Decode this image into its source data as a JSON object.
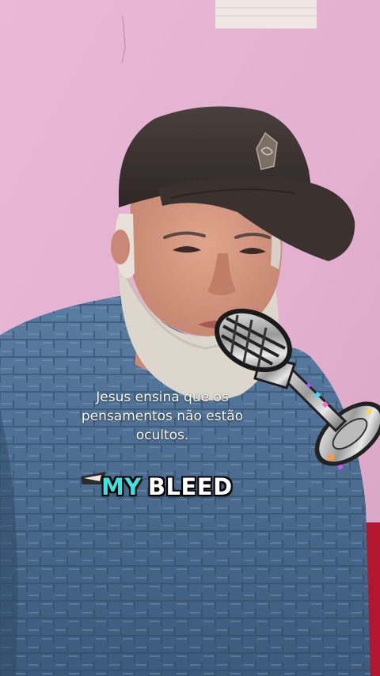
{
  "caption": {
    "line1": "Jesus ensina que os",
    "line2": "pensamentos não estão",
    "line3": "ocultos."
  },
  "lyric": {
    "word1": "MY",
    "word2": "BLEED"
  },
  "colors": {
    "wall": "#e6b4d2",
    "sweater": "#4f7196",
    "cap": "#3e3533",
    "lyric_accent": "#3de3e0"
  }
}
